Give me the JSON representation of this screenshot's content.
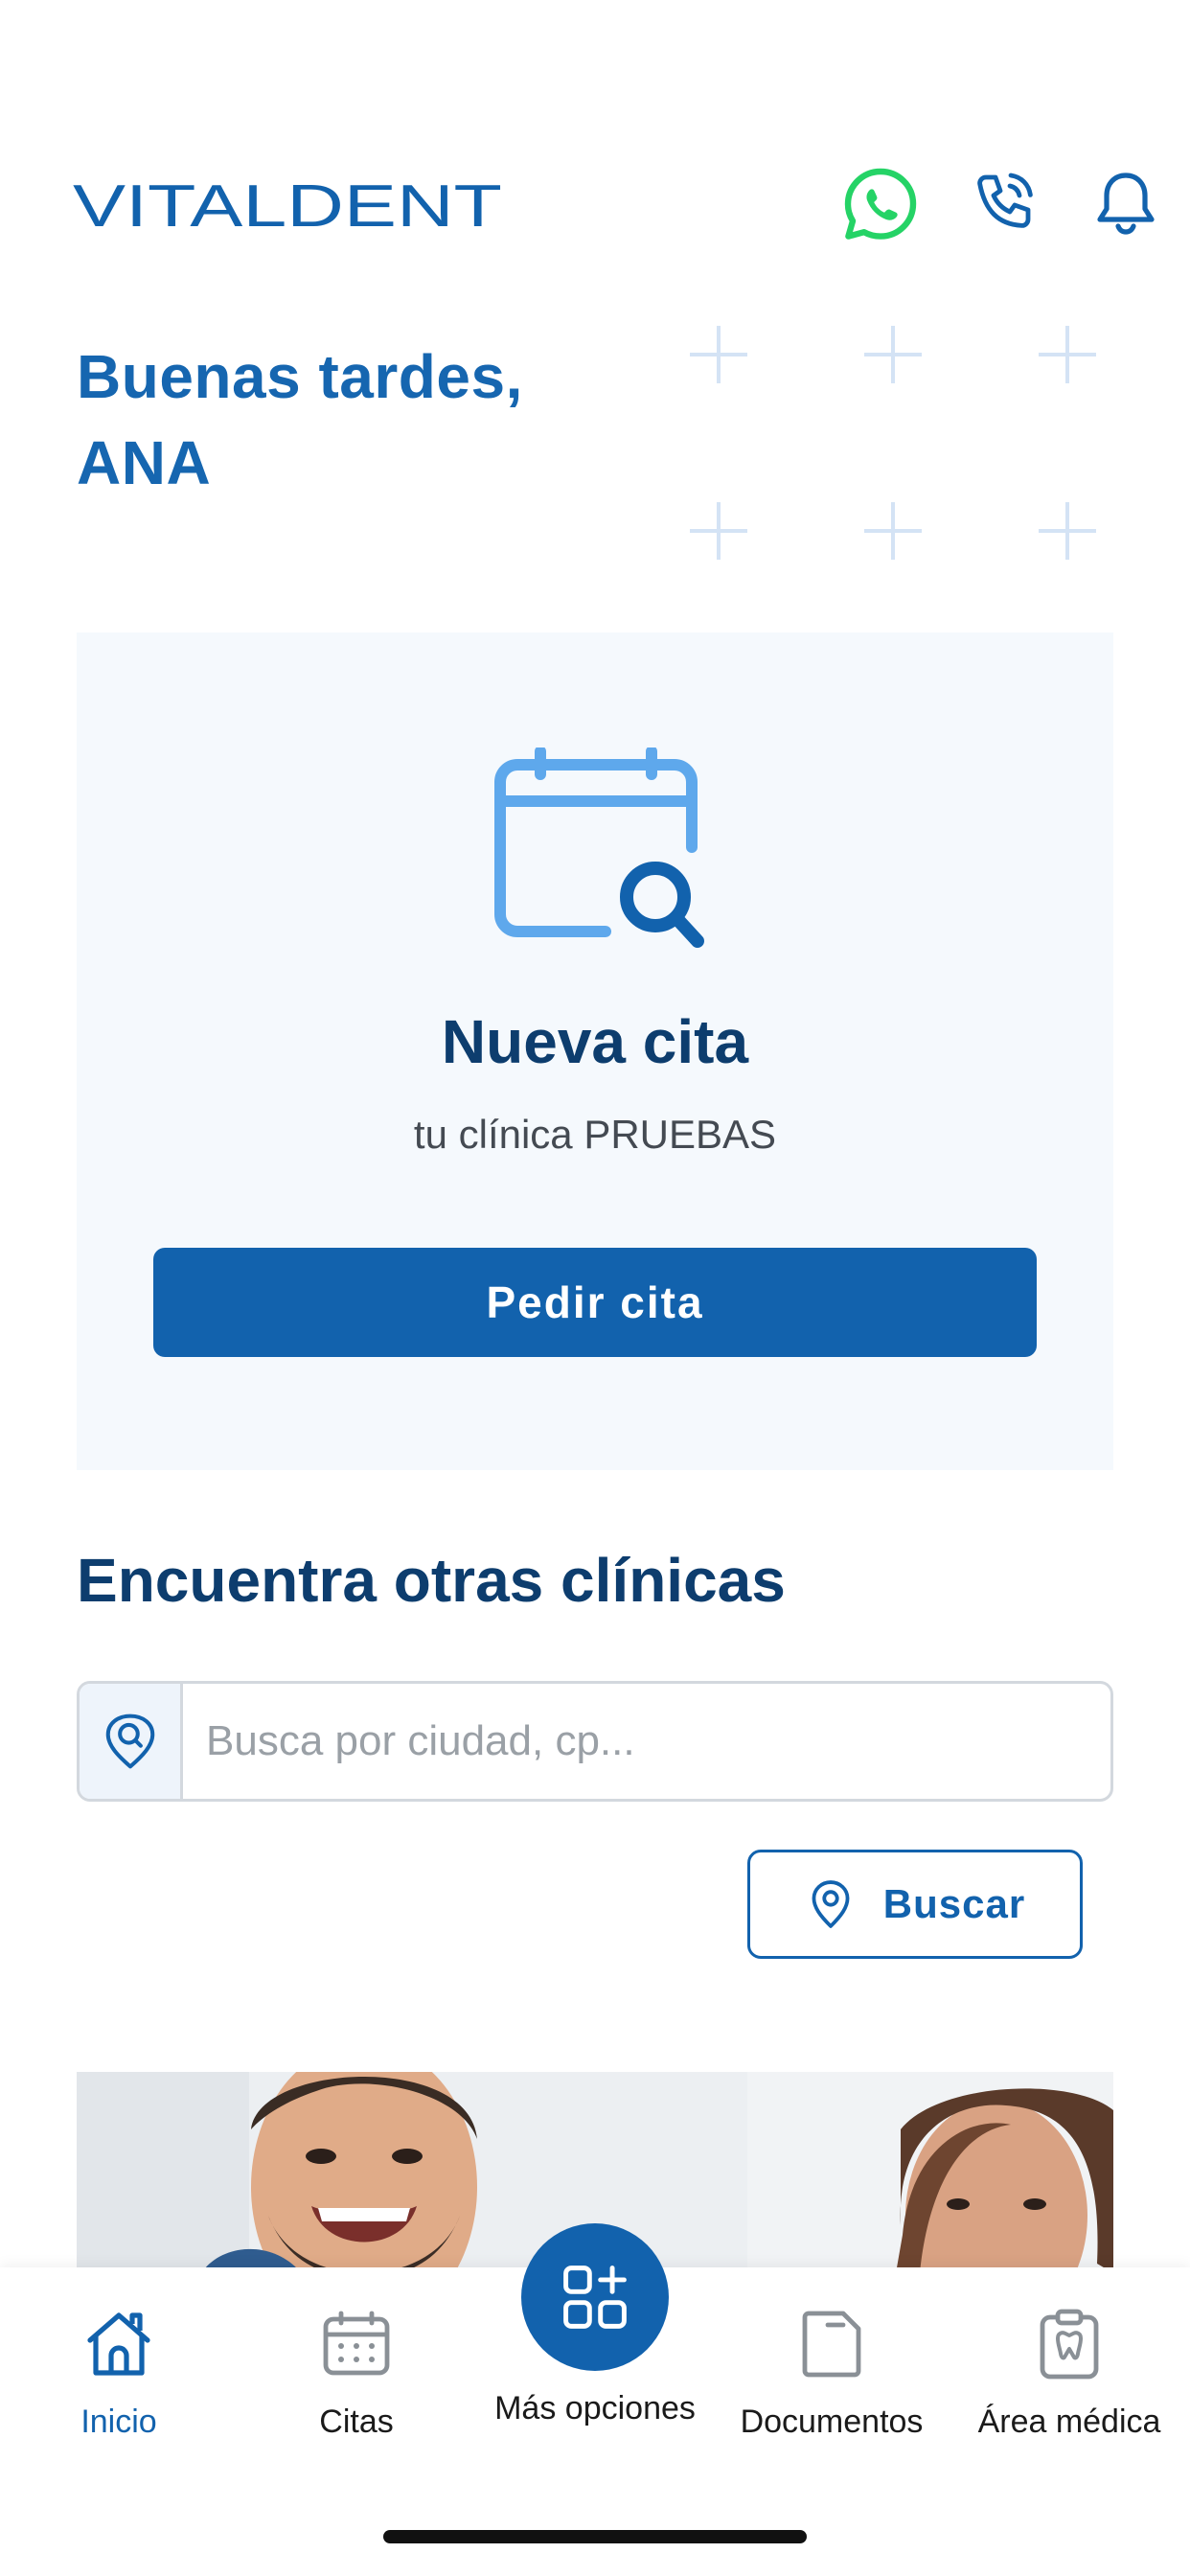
{
  "header": {
    "logo_text": "VITALDENT",
    "icons": [
      "whatsapp-icon",
      "phone-icon",
      "bell-icon"
    ]
  },
  "greeting": {
    "line1": "Buenas tardes,",
    "line2": "ANA"
  },
  "appointment_card": {
    "icon": "calendar-search-icon",
    "title": "Nueva cita",
    "subtitle": "tu clínica PRUEBAS",
    "button_label": "Pedir cita"
  },
  "find_clinics": {
    "title": "Encuentra otras clínicas",
    "search_placeholder": "Busca por ciudad, cp...",
    "search_icon": "location-search-icon",
    "button_label": "Buscar",
    "button_icon": "location-pin-icon"
  },
  "bottom_nav": {
    "items": [
      {
        "label": "Inicio",
        "icon": "home-icon",
        "active": true
      },
      {
        "label": "Citas",
        "icon": "calendar-icon",
        "active": false
      },
      {
        "label": "Más opciones",
        "icon": "grid-plus-icon",
        "active": false
      },
      {
        "label": "Documentos",
        "icon": "document-icon",
        "active": false
      },
      {
        "label": "Área médica",
        "icon": "tooth-clipboard-icon",
        "active": false
      }
    ]
  },
  "colors": {
    "brand_blue": "#1262ad",
    "title_navy": "#0d3d6e",
    "whatsapp_green": "#25d366",
    "card_bg": "#f5f9fd"
  }
}
